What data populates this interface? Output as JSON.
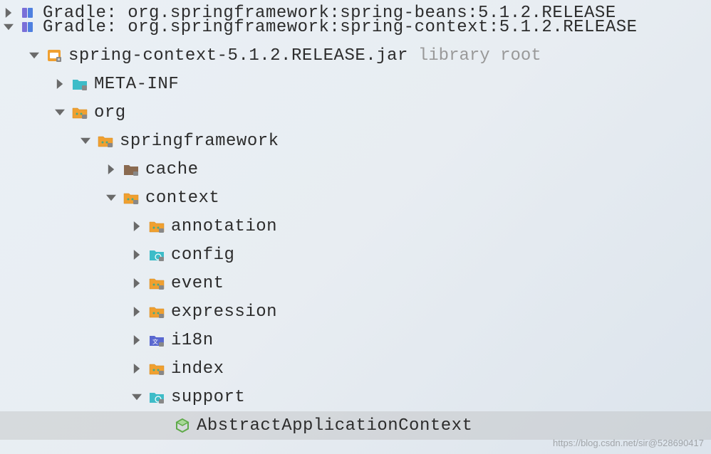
{
  "tree": {
    "row0": {
      "label": "Gradle: org.springframework:spring-beans:5.1.2.RELEASE"
    },
    "row1": {
      "label": "Gradle: org.springframework:spring-context:5.1.2.RELEASE"
    },
    "row2": {
      "label": "spring-context-5.1.2.RELEASE.jar",
      "suffix": "library root"
    },
    "row3": {
      "label": "META-INF"
    },
    "row4": {
      "label": "org"
    },
    "row5": {
      "label": "springframework"
    },
    "row6": {
      "label": "cache"
    },
    "row7": {
      "label": "context"
    },
    "row8": {
      "label": "annotation"
    },
    "row9": {
      "label": "config"
    },
    "row10": {
      "label": "event"
    },
    "row11": {
      "label": "expression"
    },
    "row12": {
      "label": "i18n"
    },
    "row13": {
      "label": "index"
    },
    "row14": {
      "label": "support"
    },
    "row15": {
      "label": "AbstractApplicationContext"
    }
  },
  "watermark": "https://blog.csdn.net/sir@528690417"
}
